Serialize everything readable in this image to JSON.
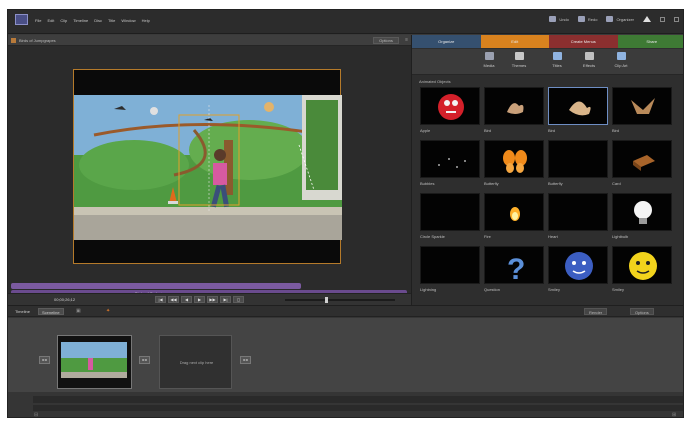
{
  "menubar": {
    "menus": [
      "File",
      "Edit",
      "Clip",
      "Timeline",
      "Disc",
      "Title",
      "Window",
      "Help"
    ],
    "right": [
      {
        "label": "Undo",
        "icon": "undo-icon"
      },
      {
        "label": "Redo",
        "icon": "redo-icon"
      },
      {
        "label": "Organizer",
        "icon": "organizer-icon"
      }
    ]
  },
  "project": {
    "title": "Birds of Jumpgrapes",
    "options_label": "Options"
  },
  "clipbar": {
    "label": "Birds of Orch ▲"
  },
  "transport": {
    "timecode": "00;00;26;12",
    "buttons": [
      "|◀",
      "◀◀",
      "◀",
      "▶",
      "▶▶",
      "▶|",
      "◻"
    ]
  },
  "right_panel": {
    "tabs": [
      {
        "label": "Organize",
        "color": "#35506f"
      },
      {
        "label": "Edit",
        "color": "#d9821e"
      },
      {
        "label": "Create Menus",
        "color": "#8b2f2f"
      },
      {
        "label": "Share",
        "color": "#3e7a34"
      }
    ],
    "tools": [
      {
        "label": "Media",
        "icon": "media-icon",
        "color": "#9aa0b0"
      },
      {
        "label": "Themes",
        "icon": "themes-icon",
        "color": "#c8c8c8"
      },
      {
        "label": "Titles",
        "icon": "titles-icon",
        "color": "#8fb3e0"
      },
      {
        "label": "Effects",
        "icon": "effects-icon",
        "color": "#c0c0c0"
      },
      {
        "label": "Clip Art",
        "icon": "clip-art-icon",
        "color": "#8fb3e0"
      }
    ],
    "category": "Animated Objects",
    "items": [
      {
        "label": "Apple",
        "icon": "apple-art-icon"
      },
      {
        "label": "Bird",
        "icon": "bird-1-icon"
      },
      {
        "label": "Bird",
        "icon": "bird-2-icon",
        "selected": true
      },
      {
        "label": "Bird",
        "icon": "bird-3-icon"
      },
      {
        "label": "Bubbles",
        "icon": "bubbles-icon"
      },
      {
        "label": "Butterfly",
        "icon": "butterfly-1-icon"
      },
      {
        "label": "Butterfly",
        "icon": "butterfly-2-icon"
      },
      {
        "label": "Card",
        "icon": "card-icon"
      },
      {
        "label": "Circle Sparkle",
        "icon": "sparkle-icon"
      },
      {
        "label": "Fire",
        "icon": "fire-icon"
      },
      {
        "label": "Heart",
        "icon": "heart-icon"
      },
      {
        "label": "Lightbulb",
        "icon": "lightbulb-icon"
      },
      {
        "label": "Lightning",
        "icon": "lightning-icon"
      },
      {
        "label": "Question",
        "icon": "question-icon"
      },
      {
        "label": "Smiley",
        "icon": "smiley-blue-icon"
      },
      {
        "label": "Smiley",
        "icon": "smiley-yellow-icon"
      }
    ]
  },
  "bottom": {
    "tabs": [
      "Timeline",
      "Sceneline"
    ],
    "right": [
      "Render",
      "Options"
    ],
    "drop_text": "Drag next clip here"
  }
}
